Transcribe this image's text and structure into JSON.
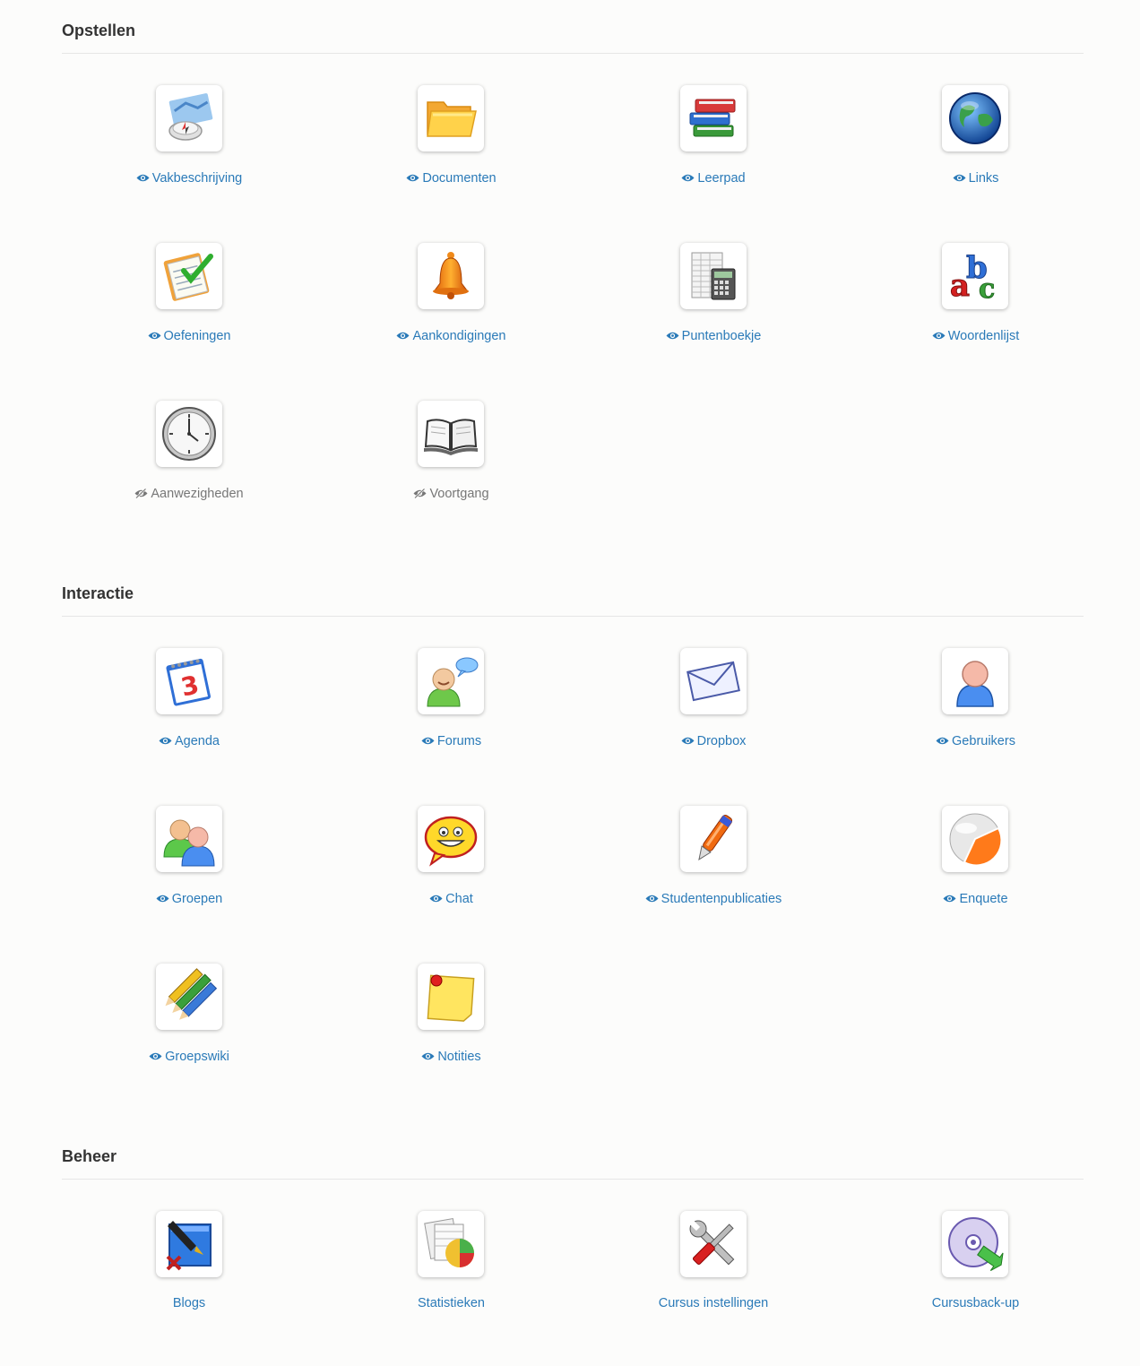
{
  "sections": [
    {
      "title": "Opstellen",
      "tools": [
        {
          "label": "Vakbeschrijving",
          "icon": "course-description-icon",
          "visible": true
        },
        {
          "label": "Documenten",
          "icon": "folder-icon",
          "visible": true
        },
        {
          "label": "Leerpad",
          "icon": "books-icon",
          "visible": true
        },
        {
          "label": "Links",
          "icon": "globe-icon",
          "visible": true
        },
        {
          "label": "Oefeningen",
          "icon": "checklist-icon",
          "visible": true
        },
        {
          "label": "Aankondigingen",
          "icon": "bell-icon",
          "visible": true
        },
        {
          "label": "Puntenboekje",
          "icon": "calculator-icon",
          "visible": true
        },
        {
          "label": "Woordenlijst",
          "icon": "abc-icon",
          "visible": true
        },
        {
          "label": "Aanwezigheden",
          "icon": "clock-icon",
          "visible": false
        },
        {
          "label": "Voortgang",
          "icon": "open-book-icon",
          "visible": false
        }
      ]
    },
    {
      "title": "Interactie",
      "tools": [
        {
          "label": "Agenda",
          "icon": "calendar-icon",
          "visible": true
        },
        {
          "label": "Forums",
          "icon": "forum-user-icon",
          "visible": true
        },
        {
          "label": "Dropbox",
          "icon": "envelope-icon",
          "visible": true
        },
        {
          "label": "Gebruikers",
          "icon": "user-icon",
          "visible": true
        },
        {
          "label": "Groepen",
          "icon": "group-icon",
          "visible": true
        },
        {
          "label": "Chat",
          "icon": "smiley-chat-icon",
          "visible": true
        },
        {
          "label": "Studentenpublicaties",
          "icon": "pen-icon",
          "visible": true
        },
        {
          "label": "Enquete",
          "icon": "survey-icon",
          "visible": true
        },
        {
          "label": "Groepswiki",
          "icon": "pencils-icon",
          "visible": true
        },
        {
          "label": "Notities",
          "icon": "sticky-note-icon",
          "visible": true
        }
      ]
    },
    {
      "title": "Beheer",
      "tools": [
        {
          "label": "Blogs",
          "icon": "blog-pen-icon",
          "visible": null
        },
        {
          "label": "Statistieken",
          "icon": "statistics-icon",
          "visible": null
        },
        {
          "label": "Cursus instellingen",
          "icon": "tools-icon",
          "visible": null
        },
        {
          "label": "Cursusback-up",
          "icon": "backup-disc-icon",
          "visible": null
        }
      ]
    }
  ],
  "colors": {
    "link": "#2a7ab8",
    "hidden_link": "#777777",
    "heading": "#333333"
  }
}
